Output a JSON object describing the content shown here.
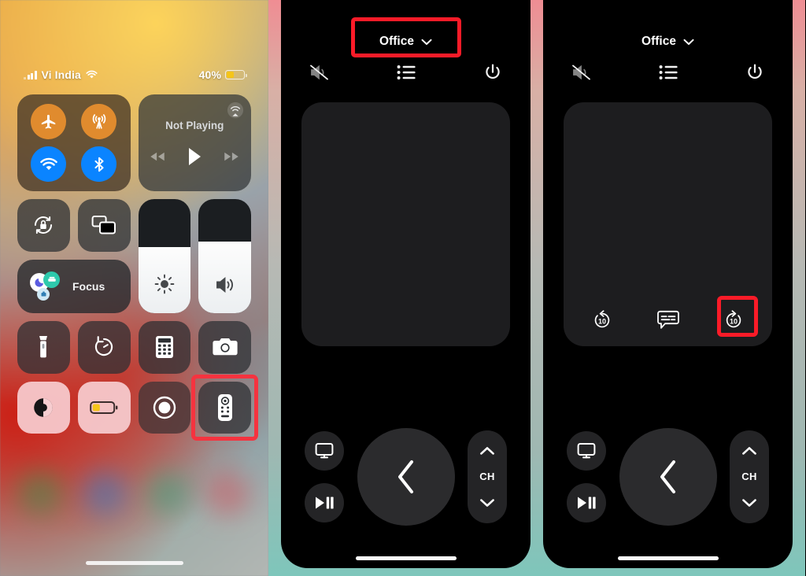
{
  "control_center": {
    "status_bar": {
      "carrier": "Vi India",
      "signal_icon": "cellular-bars-icon",
      "wifi_icon": "wifi-icon",
      "battery_percent": "40%",
      "battery_fill": 40,
      "battery_color": "#f5c518"
    },
    "connectivity": {
      "airplane_mode": "airplane-mode-icon",
      "cellular_data": "cellular-data-icon",
      "wifi": "wifi-icon",
      "bluetooth": "bluetooth-icon",
      "active_color": "#0a84ff",
      "inactive_color": "#e08b2e"
    },
    "now_playing": {
      "title": "Not Playing",
      "airplay_icon": "airplay-audio-icon",
      "rewind_icon": "rewind-icon",
      "play_icon": "play-icon",
      "forward_icon": "fast-forward-icon"
    },
    "tiles": {
      "rotation_lock": "rotation-lock-icon",
      "screen_mirroring": "screen-mirroring-icon",
      "focus_label": "Focus",
      "flashlight": "flashlight-icon",
      "timer": "timer-icon",
      "calculator": "calculator-icon",
      "camera": "camera-icon",
      "dark_mode": "dark-mode-icon",
      "low_power_mode": "low-power-battery-icon",
      "screen_record": "screen-record-icon",
      "apple_tv_remote": "tv-remote-icon"
    },
    "sliders": {
      "brightness_icon": "brightness-icon",
      "brightness_value": 58,
      "volume_icon": "volume-icon",
      "volume_value": 63
    },
    "highlight": {
      "target": "apple-tv-remote-tile",
      "color": "#f5333f"
    },
    "home_indicator": "home-indicator"
  },
  "remote_middle": {
    "device_name": "Office",
    "chevron_icon": "chevron-down-icon",
    "header_icons": {
      "mute": "mute-icon",
      "menu": "list-menu-icon",
      "power": "power-icon"
    },
    "touchpad": "touchpad-area",
    "controls": {
      "tv_app": "tv-display-icon",
      "play_pause": "play-pause-icon",
      "back": "back-chevron-icon",
      "channel_up": "chevron-up-icon",
      "channel_label": "CH",
      "channel_down": "chevron-down-icon"
    },
    "highlight": {
      "target": "device-name-selector",
      "color": "#fa1b28"
    },
    "home_indicator": "home-indicator"
  },
  "remote_right": {
    "device_name": "Office",
    "chevron_icon": "chevron-down-icon",
    "header_icons": {
      "mute": "mute-icon",
      "menu": "list-menu-icon",
      "power": "power-icon"
    },
    "media_row": {
      "skip_back": "skip-back-10-icon",
      "skip_back_label": "10",
      "captions": "captions-icon",
      "skip_forward": "skip-forward-10-icon",
      "skip_forward_label": "10"
    },
    "controls": {
      "tv_app": "tv-display-icon",
      "play_pause": "play-pause-icon",
      "back": "back-chevron-icon",
      "channel_up": "chevron-up-icon",
      "channel_label": "CH",
      "channel_down": "chevron-down-icon"
    },
    "highlight": {
      "target": "skip-forward-10-button",
      "color": "#fa1b28"
    },
    "home_indicator": "home-indicator"
  }
}
